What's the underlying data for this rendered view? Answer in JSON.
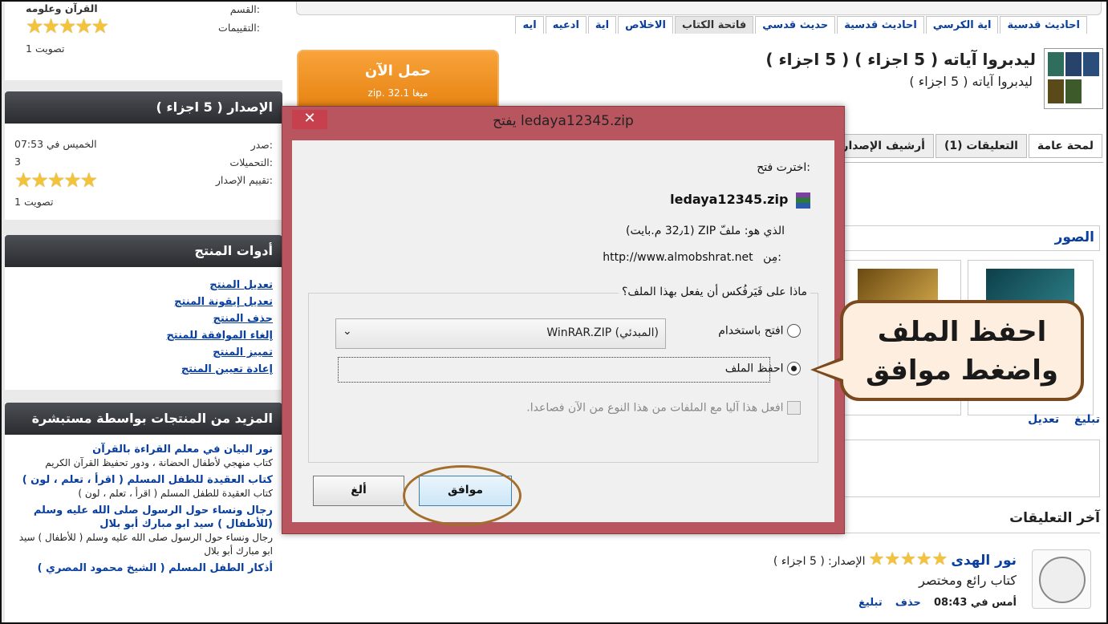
{
  "left": {
    "top_box": {
      "section_label": "القسم:",
      "section_value": "القرآن وعلومه",
      "ratings_label": "التقييمات:",
      "stars": "★★★★★",
      "votes": "1 تصويت"
    },
    "release_box": {
      "title": "الإصدار ( 5 اجزاء )",
      "issued_label": "صدر:",
      "issued_value": "الخميس في 07:53",
      "downloads_label": "التحميلات:",
      "downloads_value": "3",
      "rating_label": "تقييم الإصدار:",
      "stars": "★★★★★",
      "votes": "1 تصويت"
    },
    "tools_box": {
      "title": "أدوات المنتج",
      "items": [
        "تعديل المنتج",
        "تعديل إيقونة المنتج",
        "حذف المنتج",
        "إلغاء الموافقة للمنتج",
        "تمييز المنتج",
        "إعادة تعيين المنتج"
      ]
    },
    "more_box": {
      "title": "المزيد من المنتجات بواسطة مستبشرة",
      "items": [
        {
          "title": "نور البيان في معلم القراءة بالقرآن",
          "desc": "كتاب منهجي لأطفال الحضانة ، ودور تحفيظ القرآن الكريم"
        },
        {
          "title": "كتاب العقيدة للطفل المسلم ( اقرأ ، تعلم ، لون )",
          "desc": "كتاب العقيدة للطفل المسلم ( اقرأ ، تعلم ، لون )"
        },
        {
          "title": "رجال ونساء حول الرسول صلى الله عليه وسلم (للأطفال ) سيد ابو مبارك أبو بلال",
          "desc": "رجال ونساء حول الرسول صلى الله عليه وسلم ( للأطفال ) سيد ابو مبارك أبو بلال"
        },
        {
          "title": "أذكار الطفل المسلم ( الشيخ محمود المصري )",
          "desc": ""
        }
      ]
    }
  },
  "main": {
    "tags": [
      "احاديث قدسية",
      "اية الكرسي",
      "احاديث قدسية",
      "حديث قدسي",
      "فاتحة الكتاب",
      "الاخلاص",
      "اية",
      "ادعيه",
      "ايه"
    ],
    "active_tag_index": 4,
    "product_title": "ليدبروا آياته ( 5 اجزاء ) ( 5 اجزاء )",
    "product_subtitle": "ليدبروا آياته ( 5 اجزاء )",
    "download": {
      "label": "حمل الآن",
      "size": "zip. 32.1 ميغا"
    },
    "product_tabs": [
      "لمحة عامة",
      "التعليقات (1)",
      "أرشيف الإصدارات"
    ],
    "images_heading": "الصور",
    "actions": {
      "edit": "تعديل",
      "report": "تبليغ"
    },
    "latest_comments_heading": "آخر التعليقات",
    "comment": {
      "author": "نور الهدى",
      "stars": "★★★★★",
      "release_label": "الإصدار:",
      "release_value": "( 5 اجزاء )",
      "text": "كتاب رائع ومختصر",
      "time": "أمس في 08:43",
      "delete": "حذف",
      "report": "تبليغ"
    }
  },
  "dialog": {
    "title": "يفتح ledaya12345.zip",
    "close": "✕",
    "chosen_label": "اخترت فتح:",
    "filename": "ledaya12345.zip",
    "type_line": "الذي هو: ملفّ ZIP (32٫1 م.بايت)",
    "from_label": "مِن:",
    "from_url": "http://www.almobshrat.net",
    "question": "ماذا على فَيَرفُكس أن يفعل بهذا الملف؟",
    "open_with_label": "افتح باستخدام",
    "open_with_value": "WinRAR.ZIP (المبدئي)",
    "save_label": "احفظ الملف",
    "auto_label": "افعل هذا آليا مع الملفات من هذا النوع من الآن فصاعدا.",
    "ok": "موافق",
    "cancel": "ألغ"
  },
  "callout": {
    "line1": "احفظ الملف",
    "line2": "واضغط موافق"
  },
  "colors": {
    "link": "#0a3f9e",
    "download_orange": "#e5800e",
    "dialog_frame": "#b9555f",
    "callout_bg": "#fdeedf"
  }
}
